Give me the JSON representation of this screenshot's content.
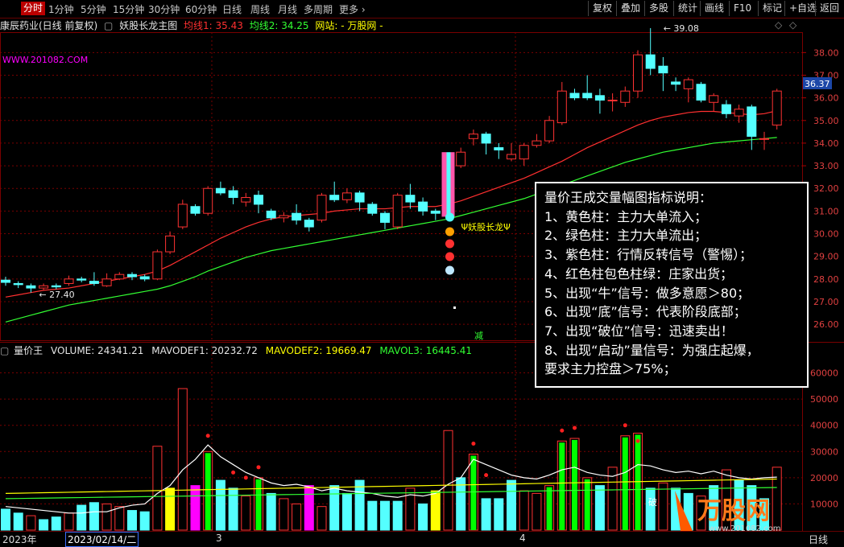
{
  "toolbar": {
    "tabs": [
      "分时",
      "1分钟",
      "5分钟",
      "15分钟",
      "30分钟",
      "60分钟",
      "日线",
      "周线",
      "月线",
      "多周期",
      "更多"
    ],
    "buttons": [
      "复权",
      "叠加",
      "多股",
      "统计",
      "画线",
      "F10",
      "标记",
      "+自选",
      "返回"
    ]
  },
  "chart_title": {
    "stock": "康辰药业(日线 前复权)",
    "indicator": "妖股长龙主图",
    "ma1_label": "均线1: 35.43",
    "ma2_label": "均线2: 34.25",
    "site_label": "网站:",
    "site_name": "- 万股网 -"
  },
  "watermark_url": "WWW.201082.COM",
  "annotations": {
    "high_label": "39.08",
    "low_label": "27.40",
    "signal_label": "Ψ妖股长龙Ψ",
    "jian_label": "减",
    "po_label": "破",
    "current_price": "36.37",
    "zoom_symbol": "◇",
    "expand_symbol": "◇"
  },
  "price_axis": [
    "38.00",
    "37.00",
    "36.00",
    "35.00",
    "34.00",
    "33.00",
    "32.00",
    "31.00",
    "30.00",
    "29.00",
    "28.00",
    "27.00",
    "26.00"
  ],
  "volume_axis": [
    "60000",
    "50000",
    "40000",
    "30000",
    "20000",
    "10000"
  ],
  "volume_title": {
    "name": "量价王",
    "volume": "VOLUME: 24341.21",
    "mavodef1": "MAVODEF1: 20232.72",
    "mavodef2": "MAVODEF2: 19669.47",
    "mavol3": "MAVOL3: 16445.41"
  },
  "notes": [
    "量价王成交量幅图指标说明：",
    "1、黄色柱：主力大单流入；",
    "2、绿色柱：主力大单流出；",
    "3、紫色柱：行情反转信号（警惕）；",
    "4、红色柱包色柱绿：庄家出货；",
    "5、出现“牛”信号：做多意愿＞80；",
    "6、出现“底”信号：代表阶段底部；",
    "7、出现“破位”信号：迅速卖出！",
    "8、出现“启动”量信号：为强庄起爆，",
    "要求主力控盘＞75%；"
  ],
  "bottom": {
    "year": "2023年",
    "date": "2023/02/14/二",
    "month3": "3",
    "month4": "4",
    "period": "日线"
  },
  "logo": {
    "text": "万股网",
    "url": "www.201082.com"
  },
  "colors": {
    "up": "#ff3232",
    "down": "#54ffff",
    "ma1": "#ff3030",
    "ma2": "#32ff32",
    "vol_yellow": "#ffff00",
    "vol_green": "#00ff00",
    "vol_purple": "#ff00ff",
    "grid": "#7a0000"
  },
  "chart_data": {
    "type": "candlestick",
    "candles": [
      {
        "o": 27.95,
        "c": 27.85,
        "h": 28.1,
        "l": 27.7
      },
      {
        "o": 27.8,
        "c": 27.75,
        "h": 27.9,
        "l": 27.6
      },
      {
        "o": 27.7,
        "c": 27.6,
        "h": 27.8,
        "l": 27.4
      },
      {
        "o": 27.6,
        "c": 27.7,
        "h": 27.8,
        "l": 27.5
      },
      {
        "o": 27.7,
        "c": 27.65,
        "h": 27.8,
        "l": 27.55
      },
      {
        "o": 27.8,
        "c": 28.0,
        "h": 28.15,
        "l": 27.7
      },
      {
        "o": 28.0,
        "c": 27.95,
        "h": 28.1,
        "l": 27.85
      },
      {
        "o": 27.9,
        "c": 27.8,
        "h": 28.3,
        "l": 27.7
      },
      {
        "o": 27.7,
        "c": 28.0,
        "h": 28.25,
        "l": 27.65
      },
      {
        "o": 28.0,
        "c": 28.2,
        "h": 28.3,
        "l": 27.95
      },
      {
        "o": 28.2,
        "c": 28.1,
        "h": 28.3,
        "l": 27.95
      },
      {
        "o": 28.1,
        "c": 28.0,
        "h": 28.2,
        "l": 27.9
      },
      {
        "o": 28.0,
        "c": 29.2,
        "h": 29.3,
        "l": 27.95
      },
      {
        "o": 29.2,
        "c": 29.9,
        "h": 30.1,
        "l": 29.1
      },
      {
        "o": 30.3,
        "c": 31.3,
        "h": 31.5,
        "l": 30.2
      },
      {
        "o": 31.2,
        "c": 30.9,
        "h": 31.3,
        "l": 30.8
      },
      {
        "o": 30.9,
        "c": 32.0,
        "h": 32.1,
        "l": 30.8
      },
      {
        "o": 32.0,
        "c": 31.8,
        "h": 32.3,
        "l": 31.7
      },
      {
        "o": 31.9,
        "c": 31.6,
        "h": 32.1,
        "l": 31.3
      },
      {
        "o": 31.4,
        "c": 31.6,
        "h": 31.8,
        "l": 31.2
      },
      {
        "o": 31.7,
        "c": 31.3,
        "h": 31.9,
        "l": 30.9
      },
      {
        "o": 31.0,
        "c": 30.7,
        "h": 31.1,
        "l": 30.6
      },
      {
        "o": 30.7,
        "c": 30.8,
        "h": 30.95,
        "l": 30.5
      },
      {
        "o": 30.9,
        "c": 30.6,
        "h": 31.3,
        "l": 30.4
      },
      {
        "o": 30.6,
        "c": 30.3,
        "h": 30.7,
        "l": 30.1
      },
      {
        "o": 30.6,
        "c": 31.7,
        "h": 31.8,
        "l": 30.5
      },
      {
        "o": 31.7,
        "c": 31.5,
        "h": 32.3,
        "l": 31.4
      },
      {
        "o": 31.5,
        "c": 31.8,
        "h": 32.0,
        "l": 31.35
      },
      {
        "o": 31.8,
        "c": 31.4,
        "h": 31.9,
        "l": 31.0
      },
      {
        "o": 31.3,
        "c": 30.9,
        "h": 31.4,
        "l": 30.8
      },
      {
        "o": 30.9,
        "c": 30.5,
        "h": 31.0,
        "l": 30.2
      },
      {
        "o": 30.3,
        "c": 31.7,
        "h": 31.8,
        "l": 30.2
      },
      {
        "o": 31.7,
        "c": 31.4,
        "h": 32.2,
        "l": 31.1
      },
      {
        "o": 31.4,
        "c": 31.0,
        "h": 31.6,
        "l": 30.8
      },
      {
        "o": 31.0,
        "c": 30.9,
        "h": 31.1,
        "l": 30.6
      },
      {
        "o": 31.0,
        "c": 32.7,
        "h": 32.8,
        "l": 30.6
      },
      {
        "o": 33.0,
        "c": 33.6,
        "h": 33.8,
        "l": 32.9
      },
      {
        "o": 34.2,
        "c": 34.4,
        "h": 34.6,
        "l": 33.9
      },
      {
        "o": 34.4,
        "c": 34.0,
        "h": 34.5,
        "l": 33.5
      },
      {
        "o": 33.8,
        "c": 33.7,
        "h": 34.0,
        "l": 33.3
      },
      {
        "o": 33.3,
        "c": 33.5,
        "h": 34.0,
        "l": 33.2
      },
      {
        "o": 33.3,
        "c": 33.9,
        "h": 34.0,
        "l": 33.0
      },
      {
        "o": 33.9,
        "c": 34.1,
        "h": 34.4,
        "l": 33.8
      },
      {
        "o": 34.1,
        "c": 35.0,
        "h": 35.2,
        "l": 34.0
      },
      {
        "o": 34.9,
        "c": 36.3,
        "h": 36.7,
        "l": 34.8
      },
      {
        "o": 36.2,
        "c": 36.0,
        "h": 36.4,
        "l": 35.9
      },
      {
        "o": 36.2,
        "c": 36.0,
        "h": 37.0,
        "l": 35.9
      },
      {
        "o": 36.1,
        "c": 35.9,
        "h": 36.4,
        "l": 35.3
      },
      {
        "o": 35.9,
        "c": 35.9,
        "h": 36.2,
        "l": 35.4
      },
      {
        "o": 35.8,
        "c": 36.3,
        "h": 36.5,
        "l": 35.6
      },
      {
        "o": 36.3,
        "c": 37.9,
        "h": 38.1,
        "l": 36.0
      },
      {
        "o": 37.9,
        "c": 37.3,
        "h": 39.08,
        "l": 37.0
      },
      {
        "o": 37.4,
        "c": 37.1,
        "h": 37.8,
        "l": 36.3
      },
      {
        "o": 36.7,
        "c": 36.6,
        "h": 36.9,
        "l": 36.3
      },
      {
        "o": 36.4,
        "c": 36.8,
        "h": 36.9,
        "l": 35.8
      },
      {
        "o": 36.6,
        "c": 35.9,
        "h": 36.7,
        "l": 35.8
      },
      {
        "o": 35.8,
        "c": 36.1,
        "h": 36.2,
        "l": 35.4
      },
      {
        "o": 35.7,
        "c": 35.3,
        "h": 35.9,
        "l": 35.1
      },
      {
        "o": 35.2,
        "c": 35.5,
        "h": 35.7,
        "l": 34.9
      },
      {
        "o": 35.6,
        "c": 34.3,
        "h": 35.7,
        "l": 33.7
      },
      {
        "o": 34.2,
        "c": 34.2,
        "h": 34.5,
        "l": 33.7
      },
      {
        "o": 34.8,
        "c": 36.3,
        "h": 36.4,
        "l": 34.6
      }
    ],
    "volumes": [
      {
        "v": 8000,
        "t": "d"
      },
      {
        "v": 6500,
        "t": "d"
      },
      {
        "v": 5500,
        "t": "u"
      },
      {
        "v": 4000,
        "t": "d"
      },
      {
        "v": 5000,
        "t": "d"
      },
      {
        "v": 6500,
        "t": "u"
      },
      {
        "v": 9500,
        "t": "d"
      },
      {
        "v": 10500,
        "t": "d"
      },
      {
        "v": 10000,
        "t": "u"
      },
      {
        "v": 9000,
        "t": "u"
      },
      {
        "v": 7500,
        "t": "d"
      },
      {
        "v": 7000,
        "t": "d"
      },
      {
        "v": 32000,
        "t": "u"
      },
      {
        "v": 16000,
        "t": "y"
      },
      {
        "v": 54000,
        "t": "u"
      },
      {
        "v": 17000,
        "t": "p"
      },
      {
        "v": 30000,
        "t": "gu"
      },
      {
        "v": 19000,
        "t": "d"
      },
      {
        "v": 16000,
        "t": "d"
      },
      {
        "v": 13000,
        "t": "u"
      },
      {
        "v": 20000,
        "t": "gu"
      },
      {
        "v": 14000,
        "t": "d"
      },
      {
        "v": 12000,
        "t": "u"
      },
      {
        "v": 10000,
        "t": "u"
      },
      {
        "v": 17000,
        "t": "p"
      },
      {
        "v": 9000,
        "t": "u"
      },
      {
        "v": 17000,
        "t": "d"
      },
      {
        "v": 14000,
        "t": "d"
      },
      {
        "v": 19000,
        "t": "d"
      },
      {
        "v": 11000,
        "t": "d"
      },
      {
        "v": 11000,
        "t": "d"
      },
      {
        "v": 11000,
        "t": "d"
      },
      {
        "v": 16000,
        "t": "u"
      },
      {
        "v": 10000,
        "t": "d"
      },
      {
        "v": 15000,
        "t": "y"
      },
      {
        "v": 38000,
        "t": "u"
      },
      {
        "v": 20000,
        "t": "d"
      },
      {
        "v": 29000,
        "t": "gu"
      },
      {
        "v": 12000,
        "t": "d"
      },
      {
        "v": 12000,
        "t": "d"
      },
      {
        "v": 19000,
        "t": "d"
      },
      {
        "v": 15000,
        "t": "u"
      },
      {
        "v": 14000,
        "t": "u"
      },
      {
        "v": 17000,
        "t": "gu"
      },
      {
        "v": 34000,
        "t": "gu"
      },
      {
        "v": 35000,
        "t": "gd"
      },
      {
        "v": 20000,
        "t": "gu"
      },
      {
        "v": 17000,
        "t": "d"
      },
      {
        "v": 24000,
        "t": "u"
      },
      {
        "v": 36000,
        "t": "gu"
      },
      {
        "v": 37000,
        "t": "gd"
      },
      {
        "v": 16000,
        "t": "d"
      },
      {
        "v": 18000,
        "t": "u"
      },
      {
        "v": 16000,
        "t": "d"
      },
      {
        "v": 14000,
        "t": "d"
      },
      {
        "v": 13000,
        "t": "u"
      },
      {
        "v": 17000,
        "t": "d"
      },
      {
        "v": 23000,
        "t": "u"
      },
      {
        "v": 19000,
        "t": "d"
      },
      {
        "v": 17000,
        "t": "d"
      },
      {
        "v": 12000,
        "t": "d"
      },
      {
        "v": 24000,
        "t": "u"
      }
    ],
    "ma1": [
      27.2,
      27.3,
      27.4,
      27.5,
      27.55,
      27.6,
      27.7,
      27.8,
      27.9,
      28.0,
      28.1,
      28.2,
      28.35,
      28.6,
      28.9,
      29.2,
      29.5,
      29.8,
      30.05,
      30.3,
      30.5,
      30.65,
      30.75,
      30.8,
      30.85,
      30.9,
      31.0,
      31.05,
      31.1,
      31.1,
      31.1,
      31.15,
      31.2,
      31.2,
      31.2,
      31.3,
      31.45,
      31.65,
      31.85,
      32.05,
      32.25,
      32.45,
      32.7,
      32.95,
      33.2,
      33.5,
      33.8,
      34.05,
      34.3,
      34.55,
      34.8,
      35.0,
      35.15,
      35.25,
      35.35,
      35.4,
      35.4,
      35.35,
      35.3,
      35.25,
      35.3,
      35.43
    ],
    "ma2": [
      26.1,
      26.25,
      26.4,
      26.55,
      26.7,
      26.85,
      26.95,
      27.05,
      27.15,
      27.25,
      27.35,
      27.45,
      27.55,
      27.7,
      27.9,
      28.1,
      28.35,
      28.55,
      28.75,
      28.95,
      29.1,
      29.25,
      29.35,
      29.45,
      29.55,
      29.65,
      29.75,
      29.85,
      29.95,
      30.05,
      30.15,
      30.25,
      30.35,
      30.45,
      30.55,
      30.65,
      30.8,
      30.95,
      31.1,
      31.25,
      31.4,
      31.55,
      31.75,
      31.95,
      32.15,
      32.35,
      32.55,
      32.75,
      32.95,
      33.15,
      33.3,
      33.45,
      33.6,
      33.7,
      33.8,
      33.9,
      34.0,
      34.05,
      34.1,
      34.15,
      34.2,
      34.25
    ],
    "vol_ma": [
      9000,
      8500,
      8000,
      7500,
      7000,
      6500,
      6500,
      7000,
      7000,
      8500,
      9500,
      10000,
      14000,
      17000,
      23000,
      27000,
      32500,
      28000,
      25000,
      22000,
      20000,
      18000,
      17000,
      17500,
      16500,
      15000,
      16000,
      15000,
      14500,
      14000,
      13000,
      12500,
      13500,
      13000,
      14000,
      17500,
      20000,
      27000,
      25000,
      23000,
      21000,
      20000,
      19500,
      21000,
      23000,
      24000,
      22000,
      21000,
      20500,
      22000,
      25000,
      24500,
      23000,
      22000,
      22500,
      21500,
      22500,
      21000,
      20000,
      19500,
      20000,
      20232
    ]
  }
}
